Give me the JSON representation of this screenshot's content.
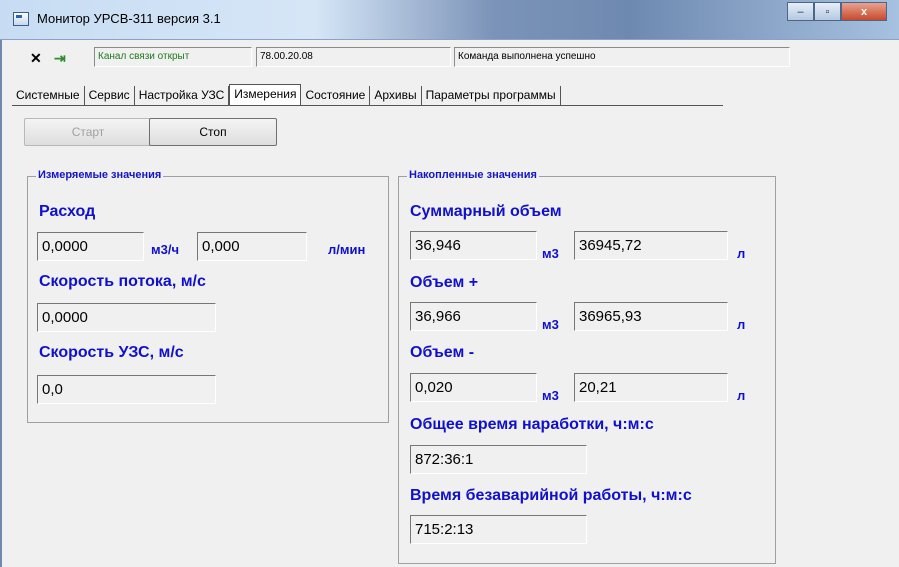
{
  "window": {
    "title": "Монитор УРСВ-311 версия 3.1",
    "buttons": {
      "minimize": "‒",
      "maximize": "▫",
      "close": "x"
    }
  },
  "status": {
    "channel": "Канал связи открыт",
    "version": "78.00.20.08",
    "message": "Команда выполнена успешно"
  },
  "tabs": [
    {
      "label": "Системные",
      "active": false
    },
    {
      "label": "Сервис",
      "active": false
    },
    {
      "label": "Настройка УЗС",
      "active": false
    },
    {
      "label": "Измерения",
      "active": true
    },
    {
      "label": "Состояние",
      "active": false
    },
    {
      "label": "Архивы",
      "active": false
    },
    {
      "label": "Параметры программы",
      "active": false
    }
  ],
  "controls": {
    "start_label": "Старт",
    "stop_label": "Стоп"
  },
  "measured": {
    "legend": "Измеряемые значения",
    "flow_label": "Расход",
    "flow_m3h": "0,0000",
    "flow_m3h_unit": "м3/ч",
    "flow_lmin": "0,000",
    "flow_lmin_unit": "л/мин",
    "speed_label": "Скорость потока, м/с",
    "speed_value": "0,0000",
    "uzs_speed_label": "Скорость УЗС, м/с",
    "uzs_speed_value": "0,0"
  },
  "accumulated": {
    "legend": "Накопленные значения",
    "total_label": "Суммарный объем",
    "total_m3": "36,946",
    "total_l": "36945,72",
    "plus_label": "Объем +",
    "plus_m3": "36,966",
    "plus_l": "36965,93",
    "minus_label": "Объем -",
    "minus_m3": "0,020",
    "minus_l": "20,21",
    "unit_m3": "м3",
    "unit_l": "л",
    "runtime_label": "Общее время наработки, ч:м:с",
    "runtime_value": "872:36:1",
    "failfree_label": "Время безаварийной работы, ч:м:с",
    "failfree_value": "715:2:13"
  },
  "colors": {
    "label_blue": "#1010cc",
    "channel_green": "#1e7a1e"
  },
  "icons": {
    "status_plug": "plug-icon",
    "status_arrow": "connection-arrow-icon"
  }
}
